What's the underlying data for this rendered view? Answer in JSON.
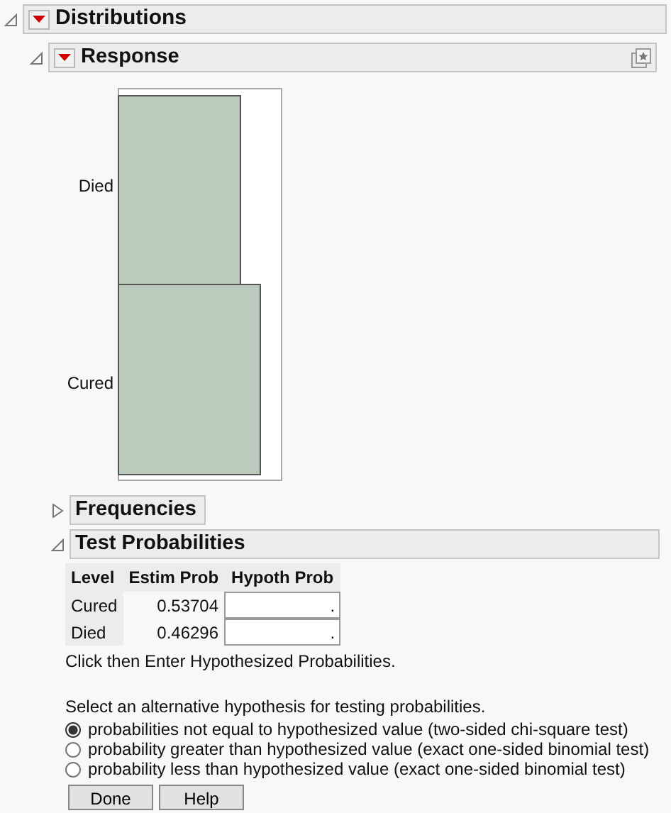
{
  "report": {
    "title": "Distributions",
    "expanded": true
  },
  "response": {
    "title": "Response",
    "expanded": true,
    "chart": {
      "labels": [
        "Died",
        "Cured"
      ]
    }
  },
  "frequencies": {
    "title": "Frequencies",
    "expanded": false
  },
  "test_probabilities": {
    "title": "Test Probabilities",
    "expanded": true,
    "columns": [
      "Level",
      "Estim Prob",
      "Hypoth Prob"
    ],
    "rows": [
      {
        "level": "Cured",
        "estim_prob": "0.53704",
        "hypoth_prob": "."
      },
      {
        "level": "Died",
        "estim_prob": "0.46296",
        "hypoth_prob": "."
      }
    ],
    "note": "Click then Enter Hypothesized Probabilities.",
    "prompt": "Select an alternative hypothesis for testing probabilities.",
    "options": [
      {
        "label": "probabilities not equal to hypothesized value (two-sided chi-square test)",
        "selected": true
      },
      {
        "label": "probability greater than hypothesized value (exact one-sided binomial test)",
        "selected": false
      },
      {
        "label": "probability less than hypothesized value (exact one-sided binomial test)",
        "selected": false
      }
    ],
    "buttons": [
      "Done",
      "Help"
    ]
  }
}
